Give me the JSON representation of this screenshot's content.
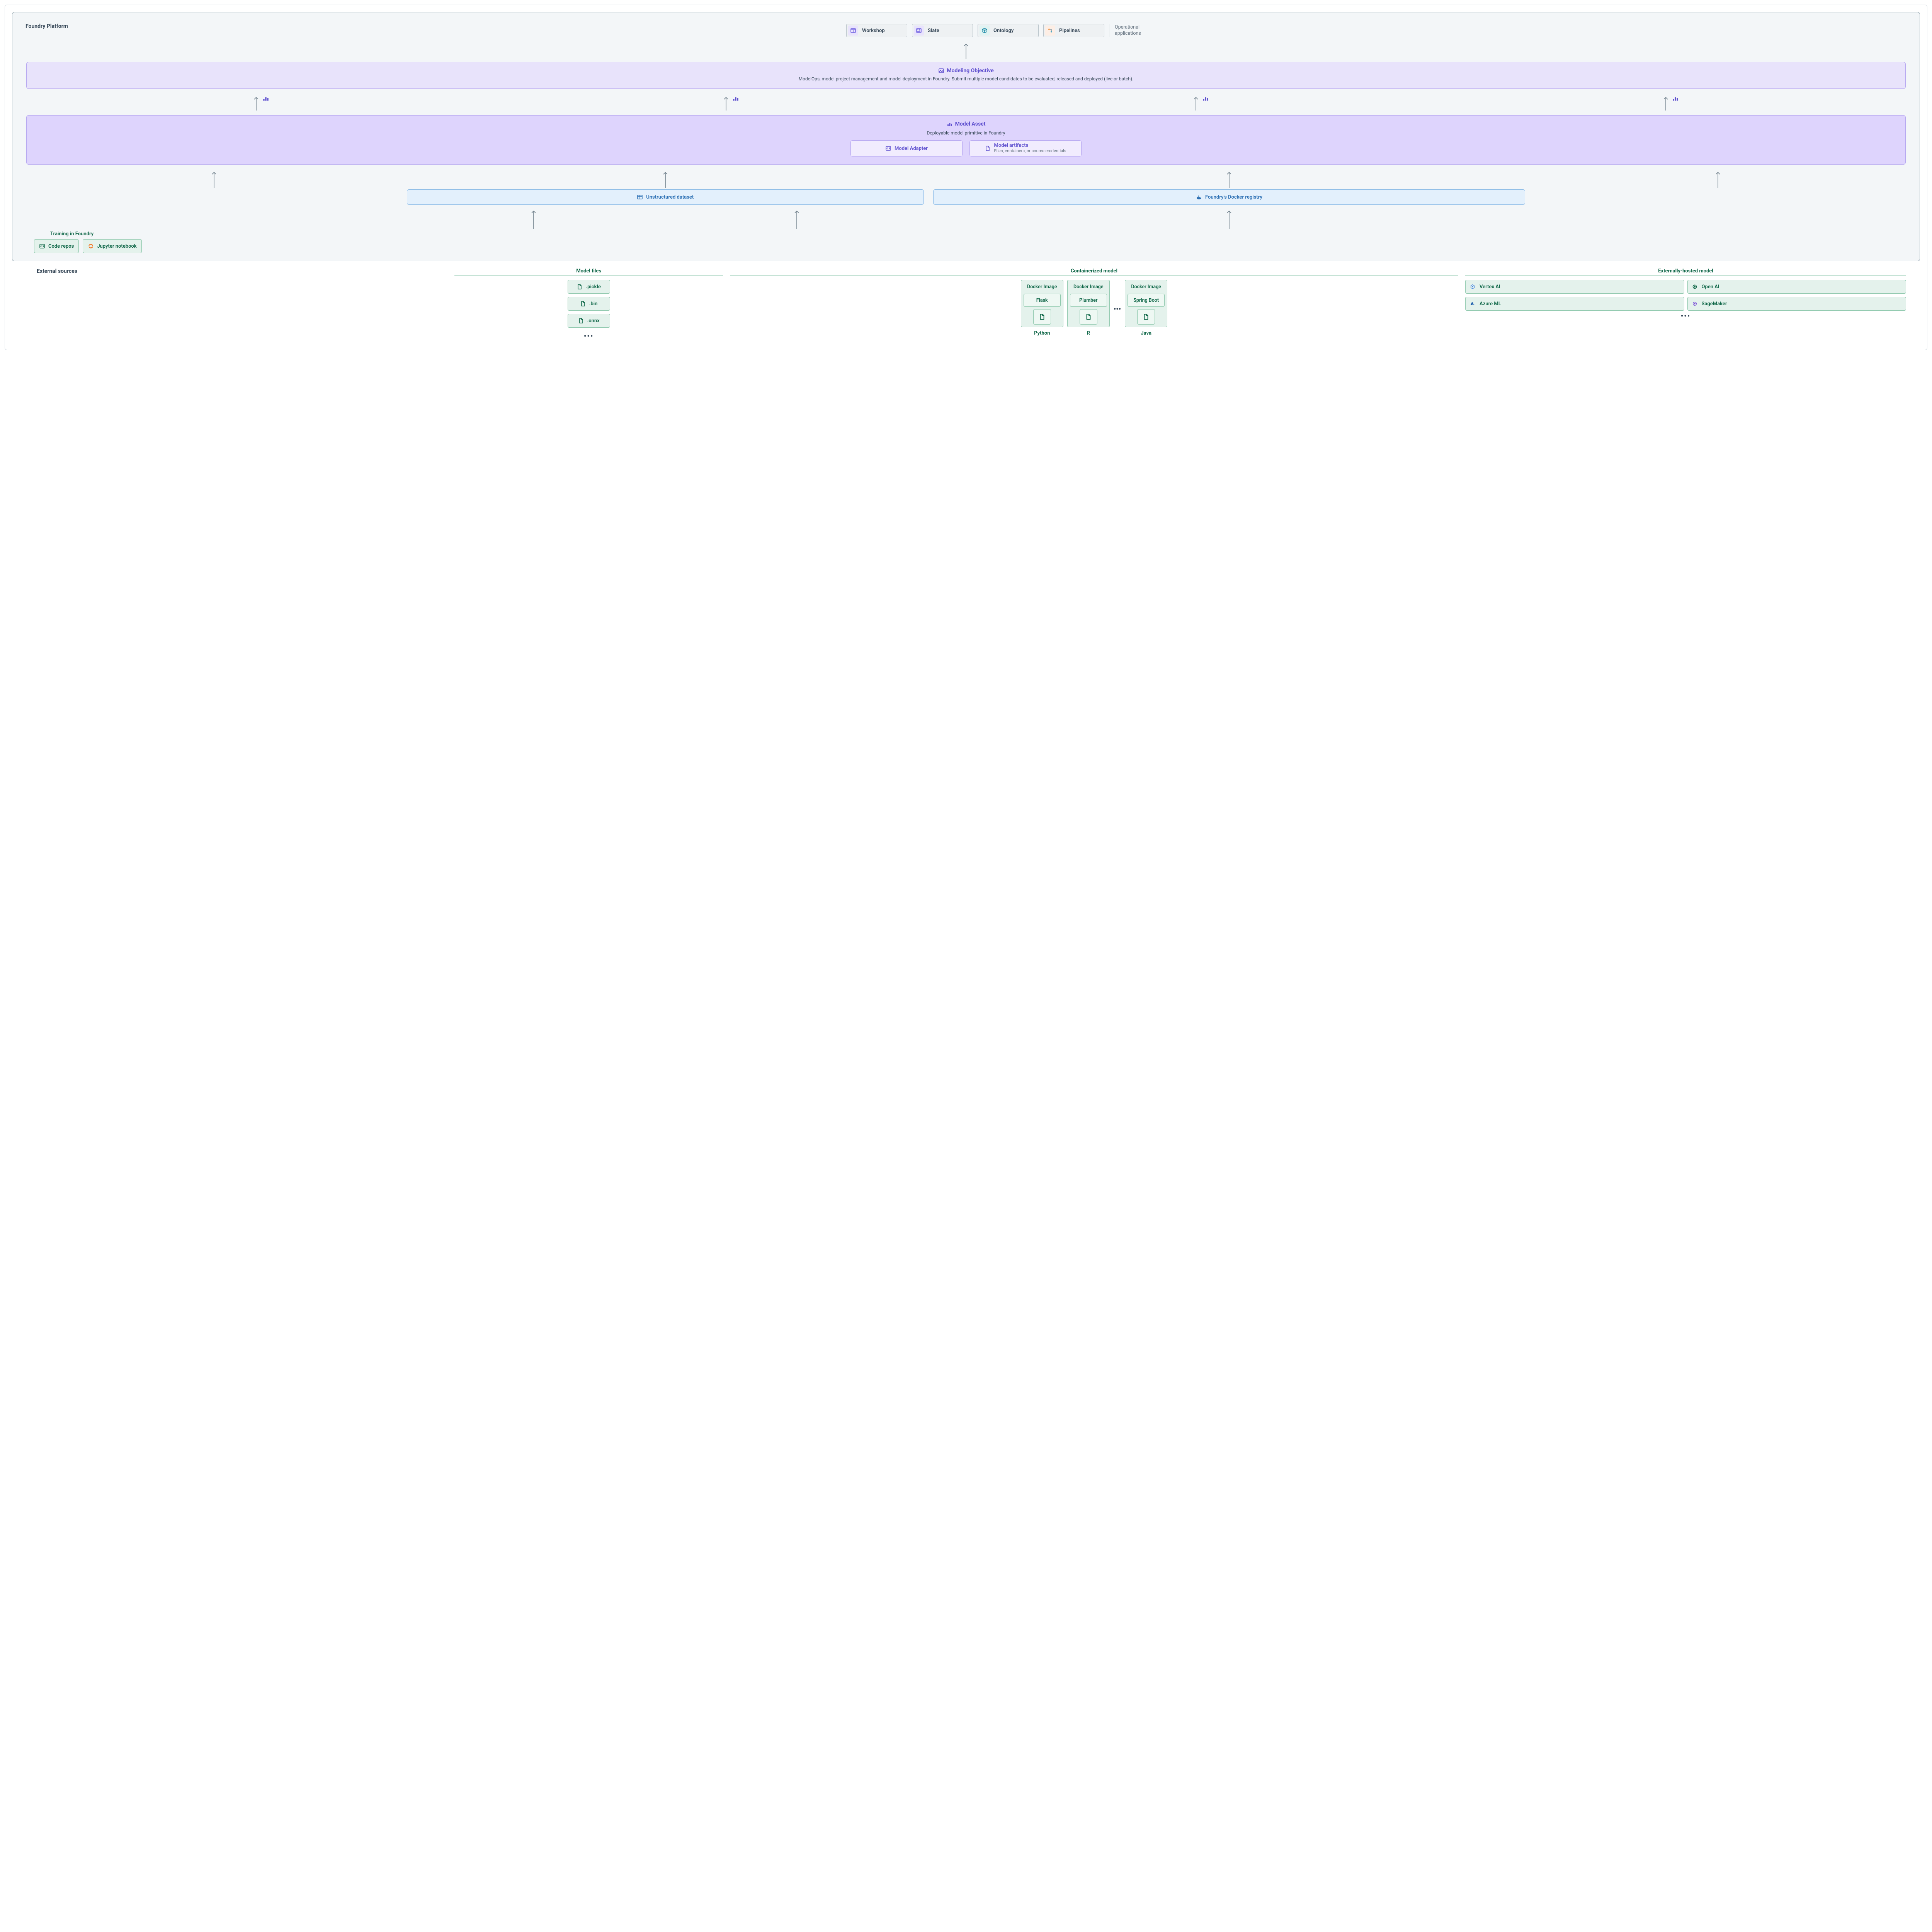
{
  "platform_title": "Foundry Platform",
  "apps": {
    "workshop": "Workshop",
    "slate": "Slate",
    "ontology": "Ontology",
    "pipelines": "Pipelines",
    "right_label_l1": "Operational",
    "right_label_l2": "applications"
  },
  "objective": {
    "title": "Modeling Objective",
    "desc": "ModelOps, model project management and model deployment in Foundry. Submit multiple model candidates to be evaluated, released and deployed (live or batch)."
  },
  "asset": {
    "title": "Model Asset",
    "subtitle": "Deployable model primitive in Foundry",
    "adapter": "Model Adapter",
    "artifacts_title": "Model artifacts",
    "artifacts_sub": "Files, containers, or source credentials"
  },
  "blue": {
    "dataset": "Unstructured dataset",
    "docker": "Foundry's Docker registry"
  },
  "training": {
    "label": "Training in Foundry",
    "code_repos": "Code repos",
    "jupyter": "Jupyter notebook"
  },
  "external": {
    "title": "External sources",
    "model_files": {
      "title": "Model files",
      "items": [
        ".pickle",
        ".bin",
        ".onnx"
      ]
    },
    "containerized": {
      "title": "Containerized model",
      "image_label": "Docker Image",
      "cols": [
        {
          "framework": "Flask",
          "lang": "Python"
        },
        {
          "framework": "Plumber",
          "lang": "R"
        },
        {
          "framework": "Spring Boot",
          "lang": "Java"
        }
      ]
    },
    "hosted": {
      "title": "Externally-hosted model",
      "items": [
        "Vertex AI",
        "Open AI",
        "Azure ML",
        "SageMaker"
      ]
    }
  }
}
